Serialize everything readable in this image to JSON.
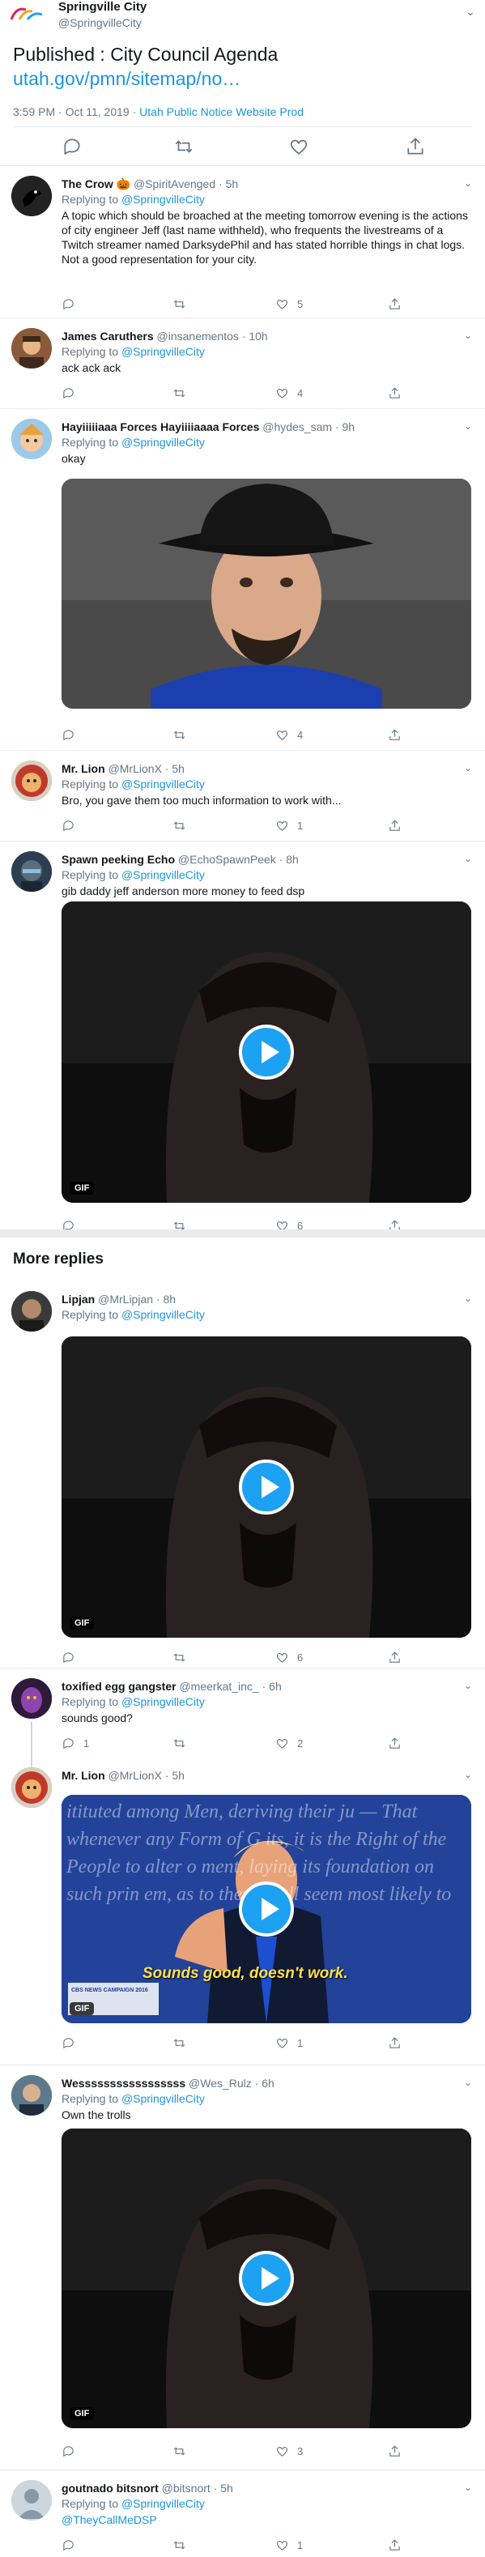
{
  "main_tweet": {
    "name": "Springville City",
    "handle": "@SpringvilleCity",
    "text": "Published : City Council Agenda",
    "link": "utah.gov/pmn/sitemap/no…",
    "time": "3:59 PM · Oct 11, 2019 · ",
    "source": "Utah Public Notice Website Prod"
  },
  "replying_prefix": "Replying to ",
  "replies": [
    {
      "name": "The Crow 🎃",
      "handle": "@SpiritAvenged · 5h",
      "to": "@SpringvilleCity",
      "text": "A topic which should be broached at the meeting tomorrow evening is the actions of city engineer Jeff (last name withheld), who frequents the livestreams of a Twitch streamer named DarksydePhil and has stated horrible things in chat logs.\nNot a good representation for your city.",
      "likes": "5"
    },
    {
      "name": "James Caruthers",
      "handle": "@insanementos · 10h",
      "to": "@SpringvilleCity",
      "text": "ack ack ack",
      "likes": "4"
    },
    {
      "name": "Hayiiiiiaaa Forces Hayiiiiaaaa Forces",
      "handle": "@hydes_sam · 9h",
      "to": "@SpringvilleCity",
      "text": "okay",
      "likes": "4"
    },
    {
      "name": "Mr. Lion",
      "handle": "@MrLionX · 5h",
      "to": "@SpringvilleCity",
      "text": "Bro, you gave them too much information to work with...",
      "likes": "1"
    },
    {
      "name": "Spawn peeking Echo",
      "handle": "@EchoSpawnPeek · 8h",
      "to": "@SpringvilleCity",
      "text": "gib daddy jeff anderson more money to feed dsp",
      "likes": "6"
    }
  ],
  "more_replies_label": "More replies",
  "more": [
    {
      "name": "Lipjan",
      "handle": "@MrLipjan · 8h",
      "to": "@SpringvilleCity",
      "text": "",
      "likes": "6"
    },
    {
      "name": "toxified egg gangster",
      "handle": "@meerkat_inc_ · 6h",
      "to": "@SpringvilleCity",
      "text": "sounds good?",
      "replies": "1",
      "likes": "2"
    },
    {
      "name": "Mr. Lion",
      "handle": "@MrLionX · 5h",
      "to": "",
      "text": "",
      "likes": "1",
      "caption": "Sounds good, doesn't work.",
      "channel": "CBS NEWS CAMPAIGN 2016",
      "bg_text": "itituted among Men, deriving their ju — That whenever any Form of G its, it is the Right of the People to alter o ment, laying its foundation on such prin em, as to them shall seem most likely to"
    },
    {
      "name": "Wesssssssssssssssss",
      "handle": "@Wes_Rulz · 6h",
      "to": "@SpringvilleCity",
      "text": "Own the trolls",
      "likes": "3"
    },
    {
      "name": "goutnado bitsnort",
      "handle": "@bitsnort · 5h",
      "to": "@SpringvilleCity",
      "text": "@TheyCallMeDSP",
      "likes": "1"
    }
  ],
  "gif_label": "GIF",
  "colors": {
    "accent": "#1b95e0",
    "secondary": "#657786",
    "divider": "#e6ecf0",
    "play": "#1da1f2"
  }
}
